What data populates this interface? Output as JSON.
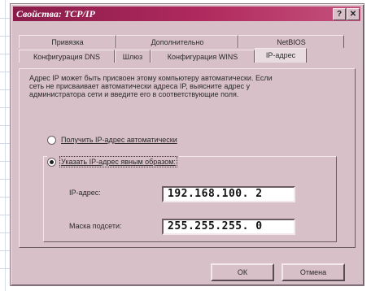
{
  "window": {
    "title": "Свойства: TCP/IP",
    "help_glyph": "?",
    "close_glyph": "✕"
  },
  "tabs_top": [
    {
      "label": "Привязка"
    },
    {
      "label": "Дополнительно"
    },
    {
      "label": "NetBIOS"
    }
  ],
  "tabs_bottom": [
    {
      "label": "Конфигурация DNS",
      "active": false
    },
    {
      "label": "Шлюз",
      "active": false
    },
    {
      "label": "Конфигурация WINS",
      "active": false
    },
    {
      "label": "IP-адрес",
      "active": true
    }
  ],
  "description": "Адрес IP может быть присвоен этому компьютеру автоматически. Если сеть не присваивает автоматически адреса IP, выясните адрес у администратора сети и введите его в соответствующие поля.",
  "radio_auto": {
    "label": "Получить IP-адрес автоматически",
    "selected": false
  },
  "radio_manual": {
    "label": "Указать IP-адрес явным образом:",
    "selected": true
  },
  "fields": {
    "ip_label": "IP-адрес:",
    "ip_value": "192.168.100.  2",
    "mask_label": "Маска подсети:",
    "mask_value": "255.255.255.  0"
  },
  "buttons": {
    "ok": "ОК",
    "cancel": "Отмена"
  },
  "colors": {
    "titlebar": "#8a1c4a",
    "face": "#d8c0c8"
  }
}
